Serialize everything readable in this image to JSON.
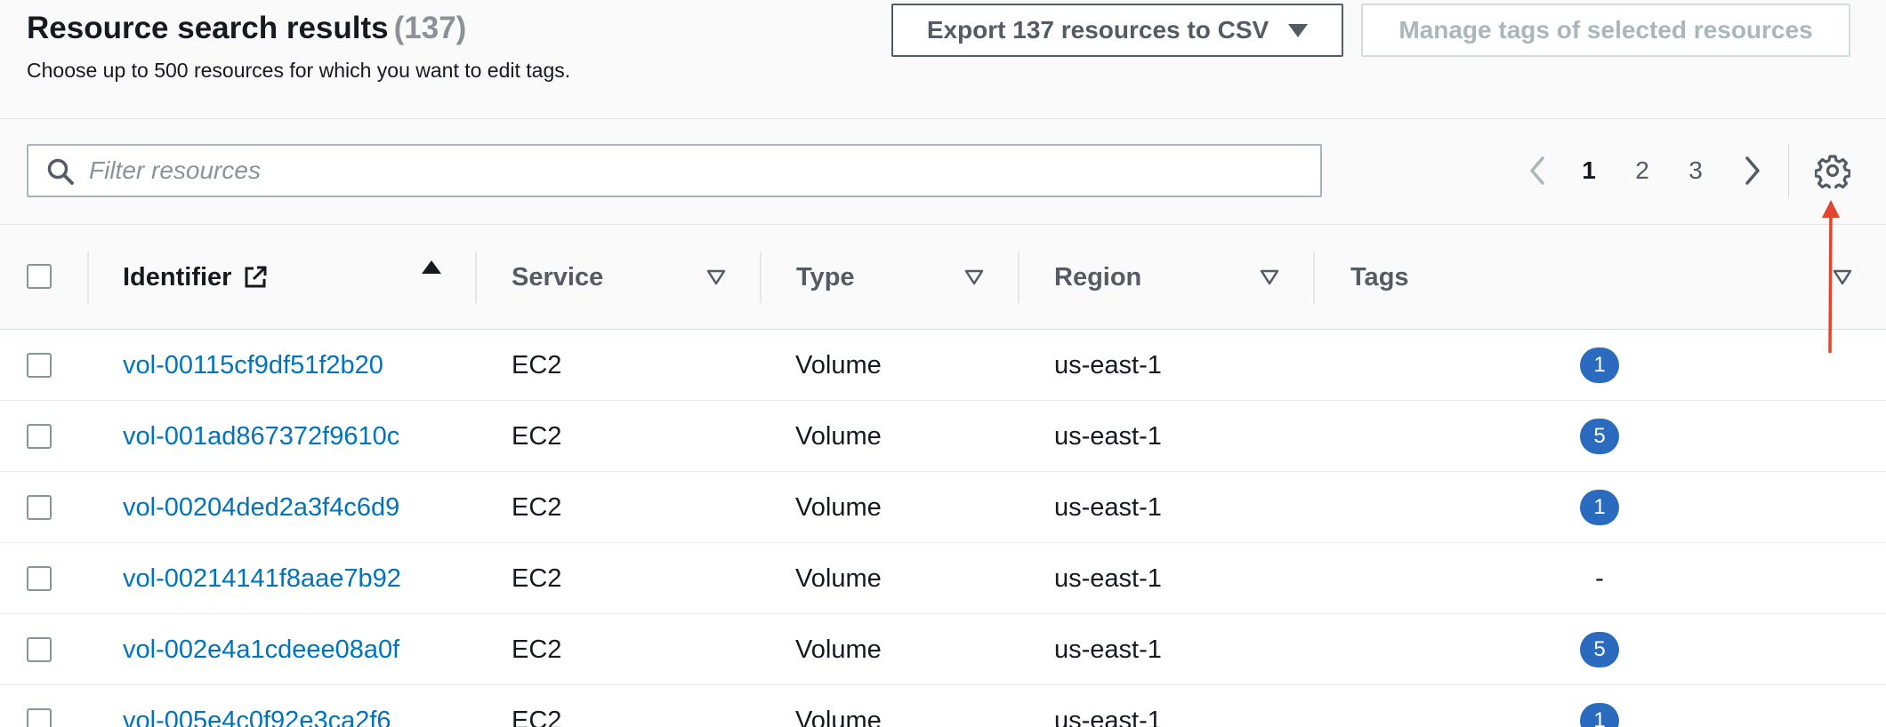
{
  "header": {
    "title": "Resource search results",
    "count": "(137)",
    "subtitle": "Choose up to 500 resources for which you want to edit tags.",
    "export_label": "Export 137 resources to CSV",
    "manage_label": "Manage tags of selected resources"
  },
  "filter": {
    "placeholder": "Filter resources",
    "value": ""
  },
  "pagination": {
    "pages": [
      "1",
      "2",
      "3"
    ],
    "current": "1"
  },
  "table": {
    "columns": [
      "Identifier",
      "Service",
      "Type",
      "Region",
      "Tags"
    ],
    "sorted_column": "Identifier",
    "sort_direction": "ascending",
    "rows": [
      {
        "identifier": "vol-00115cf9df51f2b20",
        "service": "EC2",
        "type": "Volume",
        "region": "us-east-1",
        "tags": "1"
      },
      {
        "identifier": "vol-001ad867372f9610c",
        "service": "EC2",
        "type": "Volume",
        "region": "us-east-1",
        "tags": "5"
      },
      {
        "identifier": "vol-00204ded2a3f4c6d9",
        "service": "EC2",
        "type": "Volume",
        "region": "us-east-1",
        "tags": "1"
      },
      {
        "identifier": "vol-00214141f8aae7b92",
        "service": "EC2",
        "type": "Volume",
        "region": "us-east-1",
        "tags": "-"
      },
      {
        "identifier": "vol-002e4a1cdeee08a0f",
        "service": "EC2",
        "type": "Volume",
        "region": "us-east-1",
        "tags": "5"
      },
      {
        "identifier": "vol-005e4c0f92e3ca2f6",
        "service": "EC2",
        "type": "Volume",
        "region": "us-east-1",
        "tags": "1"
      }
    ]
  },
  "colors": {
    "link": "#0073bb",
    "badge": "#2a6bbf",
    "annotation_arrow": "#e4432d"
  },
  "icons": {
    "search": "search-icon",
    "external_link": "external-link-icon",
    "settings": "gear-icon",
    "prev": "chevron-left-icon",
    "next": "chevron-right-icon"
  }
}
